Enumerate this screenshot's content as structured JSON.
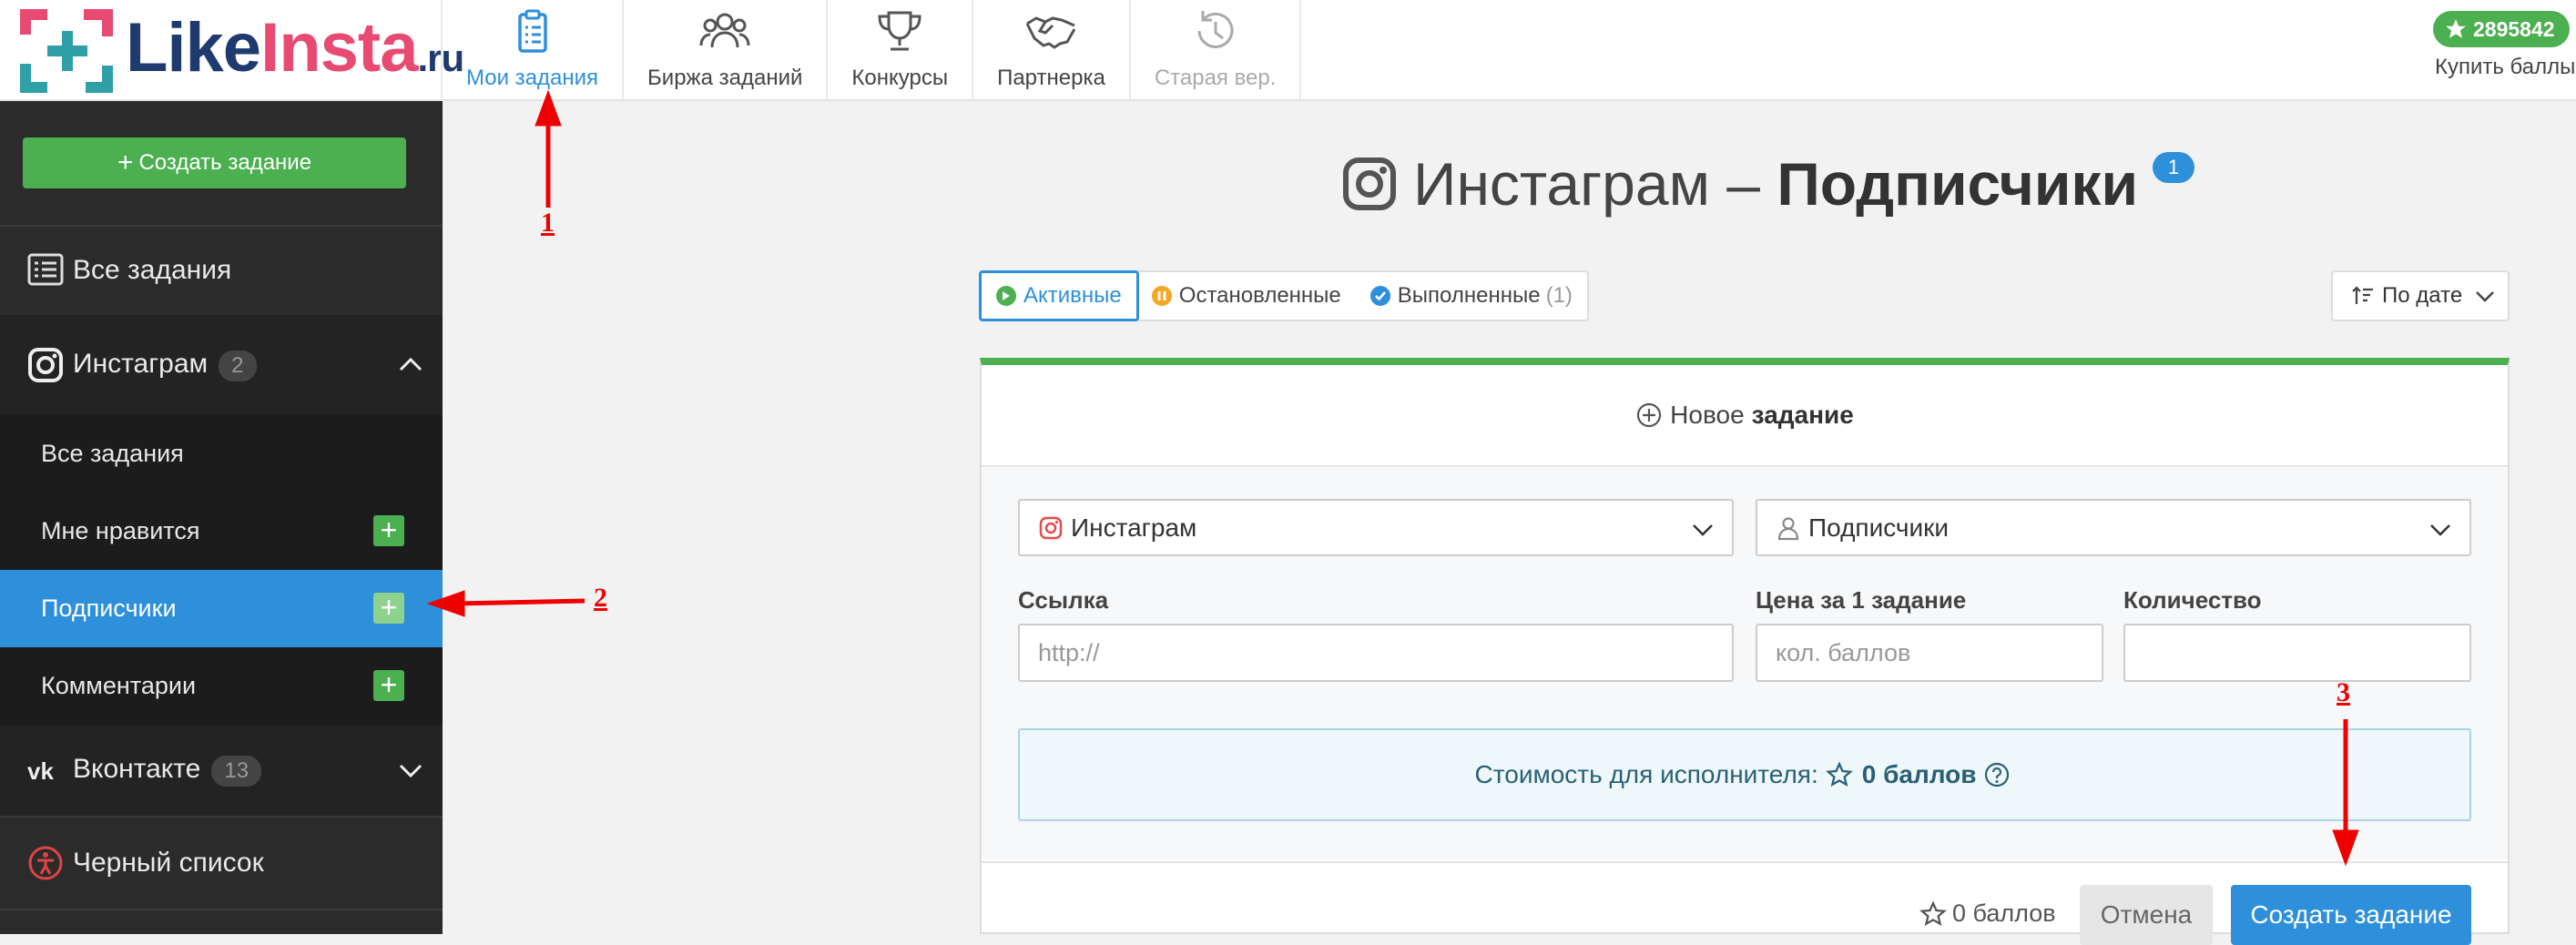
{
  "logo": {
    "like": "Like",
    "insta": "Insta",
    "ru": ".ru"
  },
  "nav": [
    {
      "label": "Мои задания",
      "icon": "clipboard-icon",
      "state": "active"
    },
    {
      "label": "Биржа заданий",
      "icon": "users-icon",
      "state": "normal"
    },
    {
      "label": "Конкурсы",
      "icon": "trophy-icon",
      "state": "normal"
    },
    {
      "label": "Партнерка",
      "icon": "handshake-icon",
      "state": "normal"
    },
    {
      "label": "Старая вер.",
      "icon": "history-icon",
      "state": "disabled"
    }
  ],
  "account": {
    "balance": "2895842",
    "buy_label": "Купить баллы"
  },
  "sidebar": {
    "create_label": "Создать задание",
    "all_tasks": "Все задания",
    "instagram": {
      "label": "Инстаграм",
      "count": "2"
    },
    "subitems": [
      {
        "label": "Все задания",
        "has_plus": false,
        "active": false
      },
      {
        "label": "Мне нравится",
        "has_plus": true,
        "active": false
      },
      {
        "label": "Подписчики",
        "has_plus": true,
        "active": true
      },
      {
        "label": "Комментарии",
        "has_plus": true,
        "active": false
      }
    ],
    "vk": {
      "label": "Вконтакте",
      "count": "13"
    },
    "blacklist": "Черный список"
  },
  "main": {
    "title_prefix": "Инстаграм –",
    "title_bold": "Подписчики",
    "title_badge": "1",
    "filters": [
      {
        "label": "Активные",
        "count": "",
        "color": "#4caf50",
        "active": true
      },
      {
        "label": "Остановленные",
        "count": "",
        "color": "#f5a623",
        "active": false
      },
      {
        "label": "Выполненные",
        "count": "(1)",
        "color": "#2e8fdb",
        "active": false
      }
    ],
    "sort_label": "По дате"
  },
  "form": {
    "head_prefix": "Новое",
    "head_bold": "задание",
    "network": "Инстаграм",
    "type": "Подписчики",
    "link_label": "Ссылка",
    "link_placeholder": "http://",
    "price_label": "Цена за 1 задание",
    "price_placeholder": "кол. баллов",
    "qty_label": "Количество",
    "qty_value": "",
    "cost_prefix": "Стоимость для исполнителя:",
    "cost_value": "0 баллов",
    "total": "0 баллов",
    "cancel": "Отмена",
    "create": "Создать задание"
  },
  "annotations": {
    "a1": "1",
    "a2": "2",
    "a3": "3"
  },
  "colors": {
    "accent": "#2e8fdb",
    "green": "#4caf50",
    "arrow": "#e00000"
  }
}
